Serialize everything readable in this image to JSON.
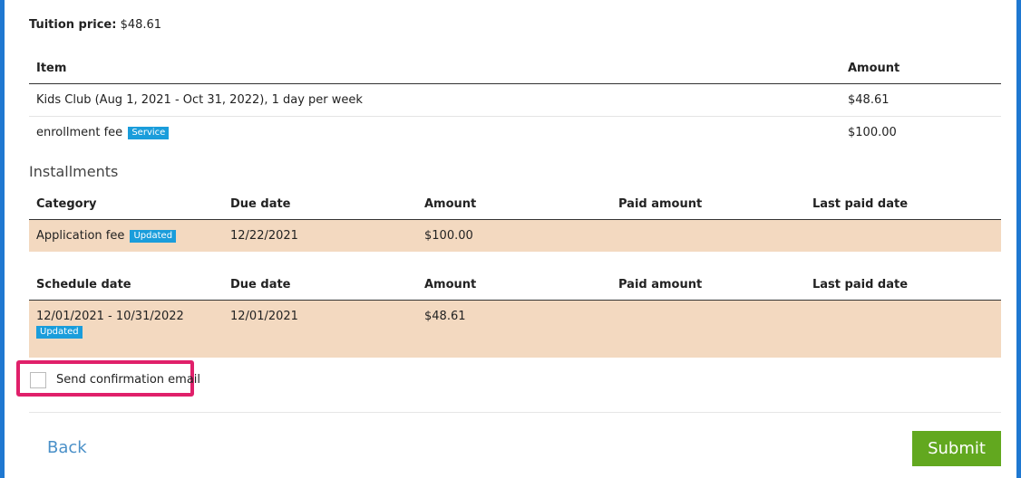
{
  "tuition": {
    "label": "Tuition price:",
    "value": "$48.61"
  },
  "items_table": {
    "headers": {
      "item": "Item",
      "amount": "Amount"
    },
    "rows": [
      {
        "item": "Kids Club (Aug 1, 2021 - Oct 31, 2022), 1 day per week",
        "badge": "",
        "amount": "$48.61"
      },
      {
        "item": "enrollment fee",
        "badge": "Service",
        "amount": "$100.00"
      }
    ]
  },
  "installments": {
    "title": "Installments",
    "headers": {
      "category": "Category",
      "due_date": "Due date",
      "amount": "Amount",
      "paid_amount": "Paid amount",
      "last_paid_date": "Last paid date"
    },
    "rows": [
      {
        "category": "Application fee",
        "badge": "Updated",
        "due_date": "12/22/2021",
        "amount": "$100.00",
        "paid_amount": "",
        "last_paid_date": ""
      }
    ]
  },
  "schedule": {
    "headers": {
      "schedule_date": "Schedule date",
      "due_date": "Due date",
      "amount": "Amount",
      "paid_amount": "Paid amount",
      "last_paid_date": "Last paid date"
    },
    "rows": [
      {
        "schedule_date": "12/01/2021 - 10/31/2022",
        "badge": "Updated",
        "due_date": "12/01/2021",
        "amount": "$48.61",
        "paid_amount": "",
        "last_paid_date": ""
      }
    ]
  },
  "confirmation": {
    "label": "Send confirmation email",
    "checked": false
  },
  "actions": {
    "back_label": "Back",
    "submit_label": "Submit"
  },
  "colors": {
    "accent_border": "#1f78d1",
    "badge": "#1a9ddb",
    "row_highlight": "#f3d9c0",
    "highlight_box": "#e0206a",
    "submit": "#62a81f",
    "link": "#4a90c8"
  }
}
